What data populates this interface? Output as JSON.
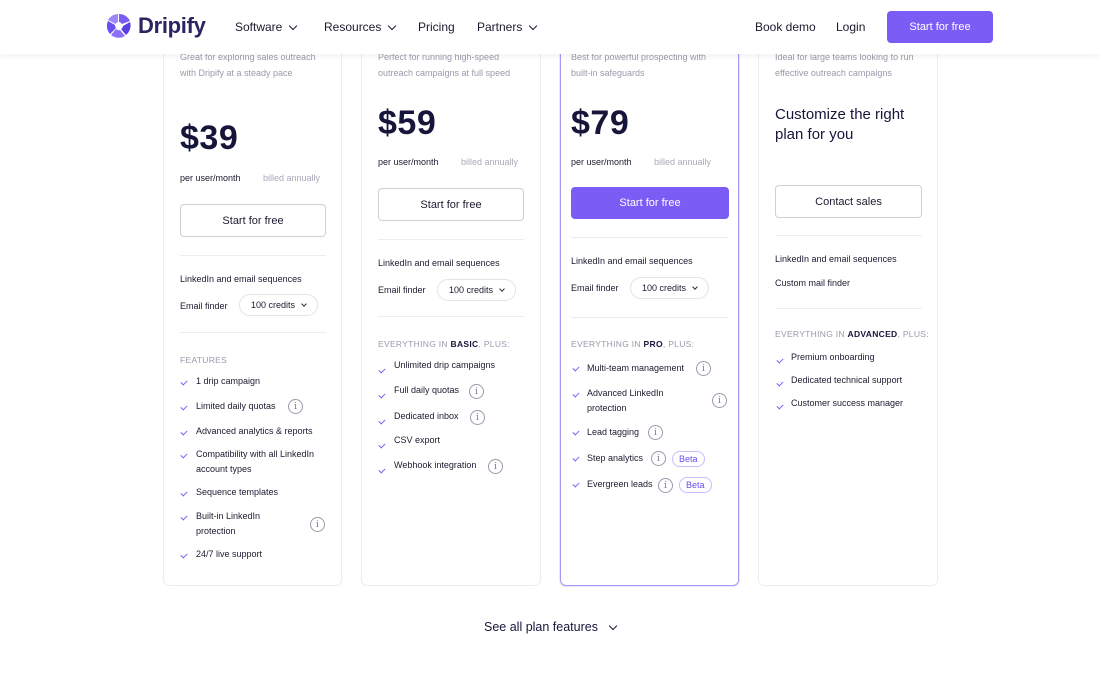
{
  "brand": {
    "name": "Dripify",
    "accent": "#7b5cf5"
  },
  "nav": {
    "software": "Software",
    "resources": "Resources",
    "pricing": "Pricing",
    "partners": "Partners",
    "book_demo": "Book demo",
    "login": "Login",
    "start_free": "Start for free"
  },
  "plans": {
    "basic": {
      "tagline": "Great for exploring sales outreach with Dripify at a steady pace",
      "price": "$39",
      "per": "per user/month",
      "billed": "billed annually",
      "cta": "Start for free",
      "sequences": "LinkedIn and email sequences",
      "email_finder": "Email finder",
      "credits": "100 credits",
      "section": "FEATURES",
      "features": [
        "1 drip campaign",
        "Limited daily quotas",
        "Advanced analytics & reports",
        "Compatibility with all LinkedIn account types",
        "Sequence templates",
        "Built-in LinkedIn protection",
        "24/7 live support"
      ]
    },
    "pro": {
      "tagline": "Perfect for running high-speed outreach campaigns at full speed",
      "price": "$59",
      "per": "per user/month",
      "billed": "billed annually",
      "cta": "Start for free",
      "sequences": "LinkedIn and email sequences",
      "email_finder": "Email finder",
      "credits": "100 credits",
      "section_prefix": "EVERYTHING IN",
      "section_plan": "BASIC",
      "section_suffix": ", PLUS:",
      "features": [
        "Unlimited drip campaigns",
        "Full daily quotas",
        "Dedicated inbox",
        "CSV export",
        "Webhook integration"
      ]
    },
    "advanced": {
      "tagline": "Best for powerful prospecting with built-in safeguards",
      "price": "$79",
      "per": "per user/month",
      "billed": "billed annually",
      "cta": "Start for free",
      "sequences": "LinkedIn and email sequences",
      "email_finder": "Email finder",
      "credits": "100 credits",
      "section_prefix": "EVERYTHING IN",
      "section_plan": "PRO",
      "section_suffix": ", PLUS:",
      "features": [
        "Multi-team management",
        "Advanced LinkedIn protection",
        "Lead tagging",
        "Step analytics",
        "Evergreen leads"
      ],
      "beta": "Beta"
    },
    "enterprise": {
      "tagline": "Ideal for large teams looking to run effective outreach campaigns",
      "title": "Customize the right plan for you",
      "cta": "Contact sales",
      "sequences": "LinkedIn and email sequences",
      "mail_finder": "Custom mail finder",
      "section_prefix": "EVERYTHING IN",
      "section_plan": "ADVANCED",
      "section_suffix": ", PLUS:",
      "features": [
        "Premium onboarding",
        "Dedicated technical support",
        "Customer success manager"
      ]
    }
  },
  "see_all": "See all plan features"
}
